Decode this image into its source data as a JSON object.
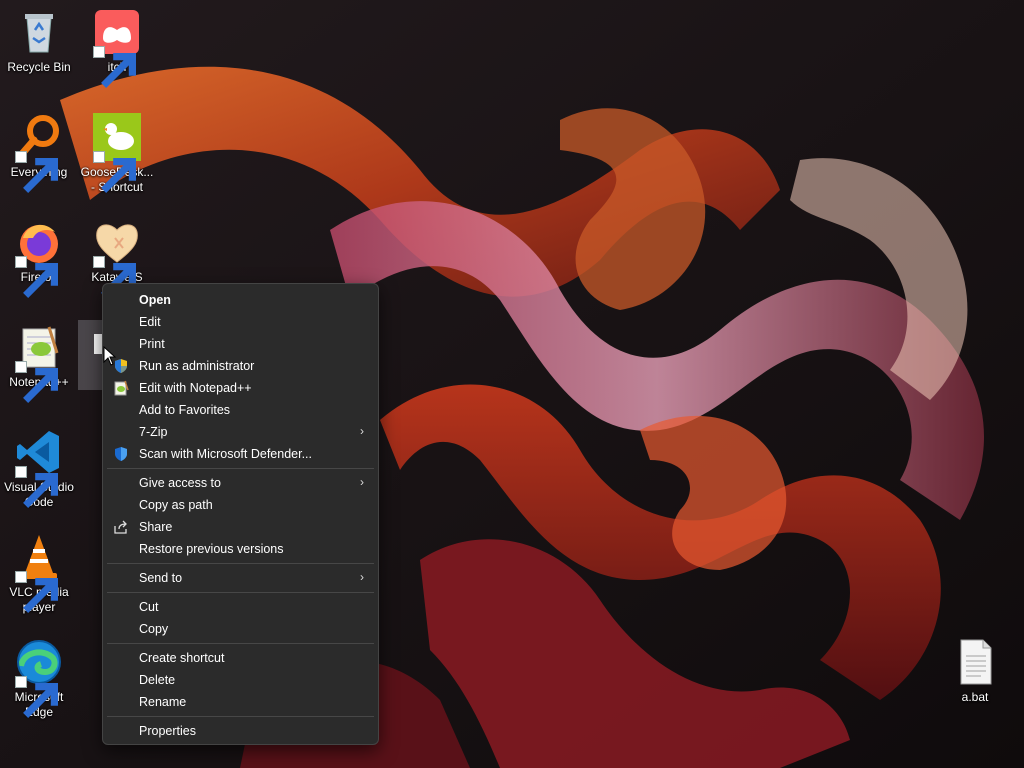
{
  "desktop": {
    "icons": [
      {
        "label": "Recycle Bin",
        "icon": "recycle-bin-icon",
        "shortcut": false
      },
      {
        "label": "itch",
        "icon": "itch-icon",
        "shortcut": true
      },
      {
        "label": "Everything",
        "icon": "everything-search-icon",
        "shortcut": true
      },
      {
        "label": "GooseDesk... - Shortcut",
        "icon": "goose-icon",
        "shortcut": true
      },
      {
        "label": "Firefox",
        "icon": "firefox-icon",
        "shortcut": true
      },
      {
        "label": "Katawa S",
        "icon": "heart-icon",
        "shortcut": true
      },
      {
        "label": "Notepad++",
        "icon": "notepad-plus-plus-icon",
        "shortcut": true
      },
      {
        "label": "Visual Studio Code",
        "icon": "vscode-icon",
        "shortcut": true
      },
      {
        "label": "VLC media player",
        "icon": "vlc-icon",
        "shortcut": true
      },
      {
        "label": "Microsoft Edge",
        "icon": "edge-icon",
        "shortcut": true
      },
      {
        "label": "a.bat",
        "icon": "batch-file-icon",
        "shortcut": false
      }
    ]
  },
  "context_menu": {
    "items": [
      {
        "label": "Open",
        "bold": true
      },
      {
        "label": "Edit"
      },
      {
        "label": "Print"
      },
      {
        "label": "Run as administrator",
        "icon": "uac-shield-icon"
      },
      {
        "label": "Edit with Notepad++",
        "icon": "notepad-plus-plus-icon"
      },
      {
        "label": "Add to Favorites"
      },
      {
        "label": "7-Zip",
        "submenu": true
      },
      {
        "label": "Scan with Microsoft Defender...",
        "icon": "defender-shield-icon"
      },
      {
        "label": "Give access to",
        "submenu": true
      },
      {
        "label": "Copy as path"
      },
      {
        "label": "Share",
        "icon": "share-icon"
      },
      {
        "label": "Restore previous versions"
      },
      {
        "label": "Send to",
        "submenu": true
      },
      {
        "label": "Cut"
      },
      {
        "label": "Copy"
      },
      {
        "label": "Create shortcut"
      },
      {
        "label": "Delete"
      },
      {
        "label": "Rename"
      },
      {
        "label": "Properties"
      }
    ],
    "submenu_arrow": "›"
  }
}
